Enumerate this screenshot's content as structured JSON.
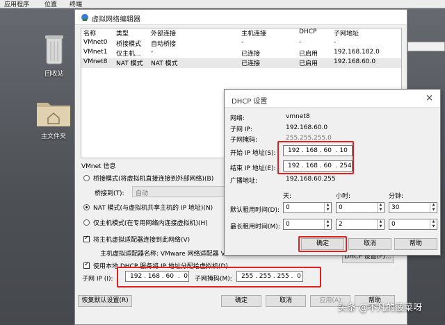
{
  "desktop": {
    "menu": [
      "应用程序",
      "位置",
      "终端"
    ],
    "icons": [
      {
        "name": "recycle-bin",
        "label": "回收站"
      },
      {
        "name": "home-folder",
        "label": "主文件夹"
      }
    ],
    "watermark": "头条 @不凡的菠菜呀"
  },
  "window": {
    "title": "虚拟网络编辑器",
    "columns": [
      "名称",
      "类型",
      "外部连接",
      "主机连接",
      "DHCP",
      "子网地址"
    ],
    "rows": [
      [
        "VMnet0",
        "桥接模式",
        "自动桥接",
        "-",
        "-",
        "-"
      ],
      [
        "VMnet1",
        "仅主机...",
        "-",
        "已连接",
        "已启用",
        "192.168.182.0"
      ],
      [
        "VMnet8",
        "NAT 模式",
        "NAT 模式",
        "已连接",
        "已启用",
        "192.168.60.0"
      ]
    ],
    "info_label": "VMnet 信息",
    "bridge_option": "桥接模式(将虚拟机直接连接到外部网络)(B)",
    "bridge_to_label": "桥接到(T):",
    "bridge_to_value": "自动",
    "nat_option": "NAT 模式(与虚拟机共享主机的 IP 地址)(N)",
    "hostonly_option": "仅主机模式(在专用网络内连接虚拟机)(H)",
    "connect_adapter": "将主机虚拟适配器连接到此网络(V)",
    "adapter_name": "主机虚拟适配器名称: VMware 网络适配器 VM",
    "use_dhcp": "使用本地 DHCP 服务将 IP 地址分配给虚拟机(D)",
    "dhcp_settings_button": "DHCP 设置(P)...",
    "subnet_ip_label": "子网 IP (I):",
    "subnet_ip": "192 . 168 . 60  .  0",
    "subnet_mask_label": "子网掩码(M):",
    "subnet_mask": "255 . 255 . 255 .  0",
    "restore_button": "恢复默认设置(R)",
    "ok": "确定",
    "cancel": "取消",
    "apply": "应用(A)",
    "help": "帮助"
  },
  "dhcp": {
    "title": "DHCP 设置",
    "network_label": "网络:",
    "network": "vmnet8",
    "subnet_ip_label": "子网 IP:",
    "subnet_ip": "192.168.60.0",
    "subnet_mask_label": "子网掩码:",
    "subnet_mask": "255.255.255.0",
    "start_label": "开始 IP 地址(S):",
    "start_ip": "192 . 168 . 60  . 10",
    "end_label": "结束 IP 地址(E):",
    "end_ip": "192 . 168 . 60  . 254",
    "broadcast_label": "广播地址:",
    "broadcast": "192.168.60.255",
    "days": "天:",
    "hours": "小时:",
    "minutes": "分钟:",
    "default_lease_label": "默认租用时间(D):",
    "default_lease": [
      "0",
      "0",
      "30"
    ],
    "max_lease_label": "最长租用时间(M):",
    "max_lease": [
      "0",
      "2",
      "0"
    ],
    "ok": "确定",
    "cancel": "取消",
    "help": "帮助"
  },
  "colors": {
    "highlight": "#e02020",
    "window_bg": "#f0f0f0"
  }
}
